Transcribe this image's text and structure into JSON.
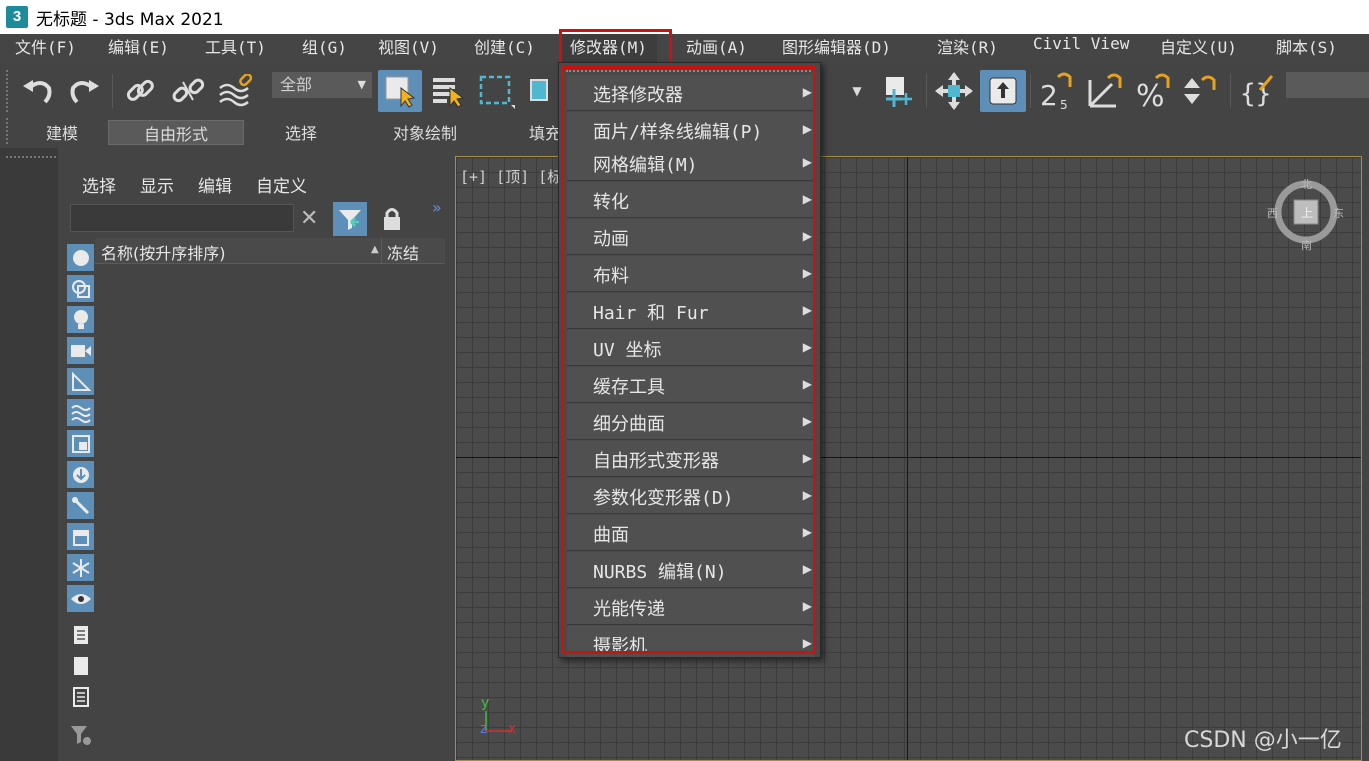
{
  "window": {
    "title": "无标题 - 3ds Max 2021",
    "app_icon": "3"
  },
  "menubar": [
    {
      "label": "文件(F)"
    },
    {
      "label": "编辑(E)"
    },
    {
      "label": "工具(T)"
    },
    {
      "label": "组(G)"
    },
    {
      "label": "视图(V)"
    },
    {
      "label": "创建(C)"
    },
    {
      "label": "修改器(M)",
      "open": true
    },
    {
      "label": "动画(A)"
    },
    {
      "label": "图形编辑器(D)"
    },
    {
      "label": "渲染(R)"
    },
    {
      "label": "Civil View"
    },
    {
      "label": "自定义(U)"
    },
    {
      "label": "脚本(S)"
    }
  ],
  "toolbar": {
    "selection_filter": "全部"
  },
  "ribbon": {
    "tabs": [
      "建模",
      "自由形式",
      "选择",
      "对象绘制",
      "填充"
    ],
    "active": "自由形式"
  },
  "explorer": {
    "tabs": [
      "选择",
      "显示",
      "编辑",
      "自定义"
    ],
    "columns": {
      "name": "名称(按升序排序)",
      "freeze": "冻结"
    }
  },
  "viewport": {
    "label": "[+] [顶] [标",
    "viewcube": {
      "north": "北",
      "south": "南",
      "east": "东",
      "west": "西",
      "face": "上"
    },
    "axis_y": "y",
    "axis_z": "z",
    "axis_x": "x"
  },
  "dropdown": {
    "items": [
      {
        "label": "选择修改器"
      },
      {
        "label": "面片/样条线编辑(P)"
      },
      {
        "label": "网格编辑(M)"
      },
      {
        "label": "转化"
      },
      {
        "label": "动画"
      },
      {
        "label": "布料"
      },
      {
        "label": "Hair 和 Fur"
      },
      {
        "label": "UV 坐标"
      },
      {
        "label": "缓存工具"
      },
      {
        "label": "细分曲面"
      },
      {
        "label": "自由形式变形器"
      },
      {
        "label": "参数化变形器(D)"
      },
      {
        "label": "曲面"
      },
      {
        "label": "NURBS 编辑(N)"
      },
      {
        "label": "光能传递"
      },
      {
        "label": "摄影机"
      }
    ]
  },
  "colors": {
    "highlight": "#cc1111",
    "active_blue": "#5e8fb9",
    "viewport_border": "#a38d4a"
  },
  "watermark": "CSDN @小一亿"
}
